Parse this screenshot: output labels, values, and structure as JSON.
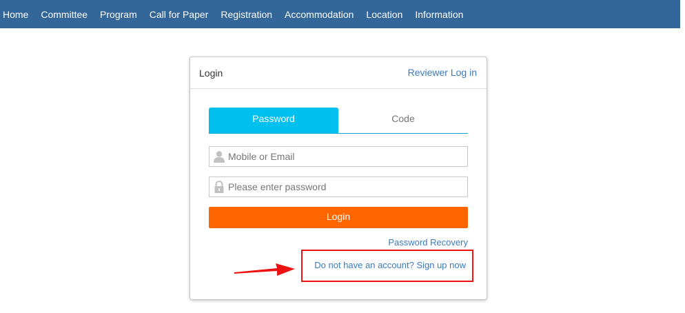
{
  "nav": {
    "items": [
      {
        "label": "Home"
      },
      {
        "label": "Committee"
      },
      {
        "label": "Program"
      },
      {
        "label": "Call for Paper"
      },
      {
        "label": "Registration"
      },
      {
        "label": "Accommodation"
      },
      {
        "label": "Location"
      },
      {
        "label": "Information"
      }
    ]
  },
  "panel": {
    "title": "Login",
    "reviewer_link": "Reviewer Log in"
  },
  "tabs": {
    "password": "Password",
    "code": "Code",
    "active": "Password"
  },
  "form": {
    "user_placeholder": "Mobile or Email",
    "user_value": "",
    "password_placeholder": "Please enter password",
    "password_value": "",
    "login_label": "Login",
    "recovery_label": "Password Recovery",
    "signup_label": "Do not have an account? Sign up now"
  },
  "colors": {
    "navbar": "#336699",
    "tab_active": "#00c0ef",
    "login_button": "#ff6600",
    "link": "#3a7bbf",
    "annotation": "#ee1111"
  },
  "icons": {
    "user_field": "user-icon",
    "password_field": "lock-icon",
    "annotation": "arrow-right-icon"
  }
}
